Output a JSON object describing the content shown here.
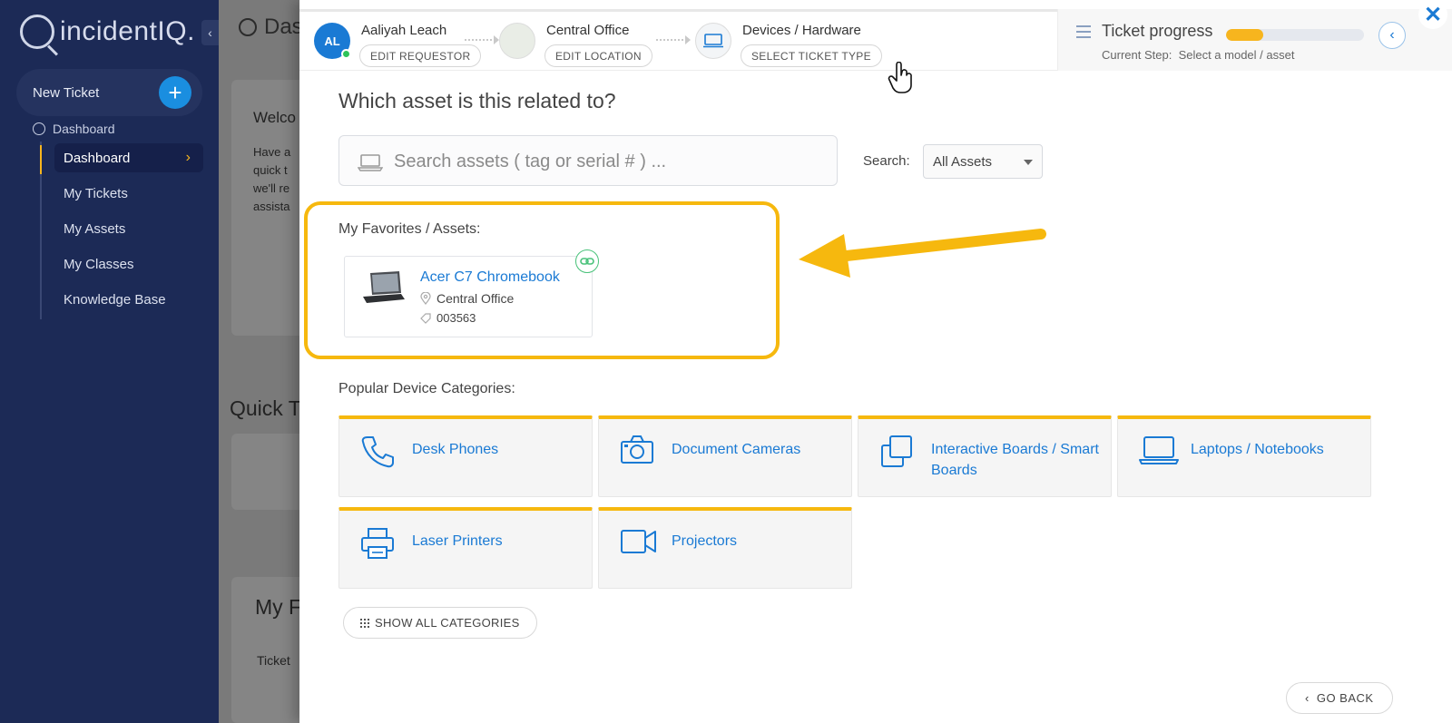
{
  "sidebar": {
    "brand": "incidentIQ.",
    "new_ticket_label": "New Ticket",
    "section_label": "Dashboard",
    "items": [
      {
        "label": "Dashboard",
        "active": true
      },
      {
        "label": "My Tickets"
      },
      {
        "label": "My Assets"
      },
      {
        "label": "My Classes"
      },
      {
        "label": "Knowledge Base"
      }
    ]
  },
  "background_page": {
    "title": "Das",
    "welcome_heading": "Welco",
    "welcome_lines": [
      "Have a",
      "quick t",
      "we'll re",
      "assista"
    ],
    "quick_heading": "Quick T",
    "my_heading": "My F",
    "ticket_col": "Ticket"
  },
  "wizard": {
    "steps": [
      {
        "title": "Aaliyah Leach",
        "action": "EDIT REQUESTOR",
        "initials": "AL"
      },
      {
        "title": "Central Office",
        "action": "EDIT LOCATION"
      },
      {
        "title": "Devices / Hardware",
        "action": "SELECT TICKET TYPE"
      }
    ],
    "progress": {
      "title": "Ticket progress",
      "percent": 0.27,
      "current_step_label": "Current Step:",
      "current_step": "Select a model / asset"
    }
  },
  "main": {
    "question": "Which asset is this related to?",
    "search": {
      "placeholder": "Search assets ( tag or serial # ) ...",
      "label": "Search:",
      "scope": "All Assets"
    },
    "favorites": {
      "title": "My Favorites / Assets:",
      "assets": [
        {
          "name": "Acer C7 Chromebook",
          "location": "Central Office",
          "tag": "003563"
        }
      ]
    },
    "categories": {
      "title": "Popular Device Categories:",
      "items": [
        {
          "label": "Desk Phones",
          "icon": "phone-icon"
        },
        {
          "label": "Document Cameras",
          "icon": "camera-icon"
        },
        {
          "label": "Interactive Boards / Smart Boards",
          "icon": "boards-icon"
        },
        {
          "label": "Laptops / Notebooks",
          "icon": "laptop-icon"
        },
        {
          "label": "Laser Printers",
          "icon": "printer-icon"
        },
        {
          "label": "Projectors",
          "icon": "projector-icon"
        }
      ]
    },
    "show_all_label": "SHOW ALL CATEGORIES",
    "go_back_label": "GO BACK"
  },
  "colors": {
    "sidebar_bg": "#1c2a56",
    "accent_blue": "#1a7ad4",
    "highlight_yellow": "#f6b80e",
    "online_green": "#2ec35a"
  }
}
